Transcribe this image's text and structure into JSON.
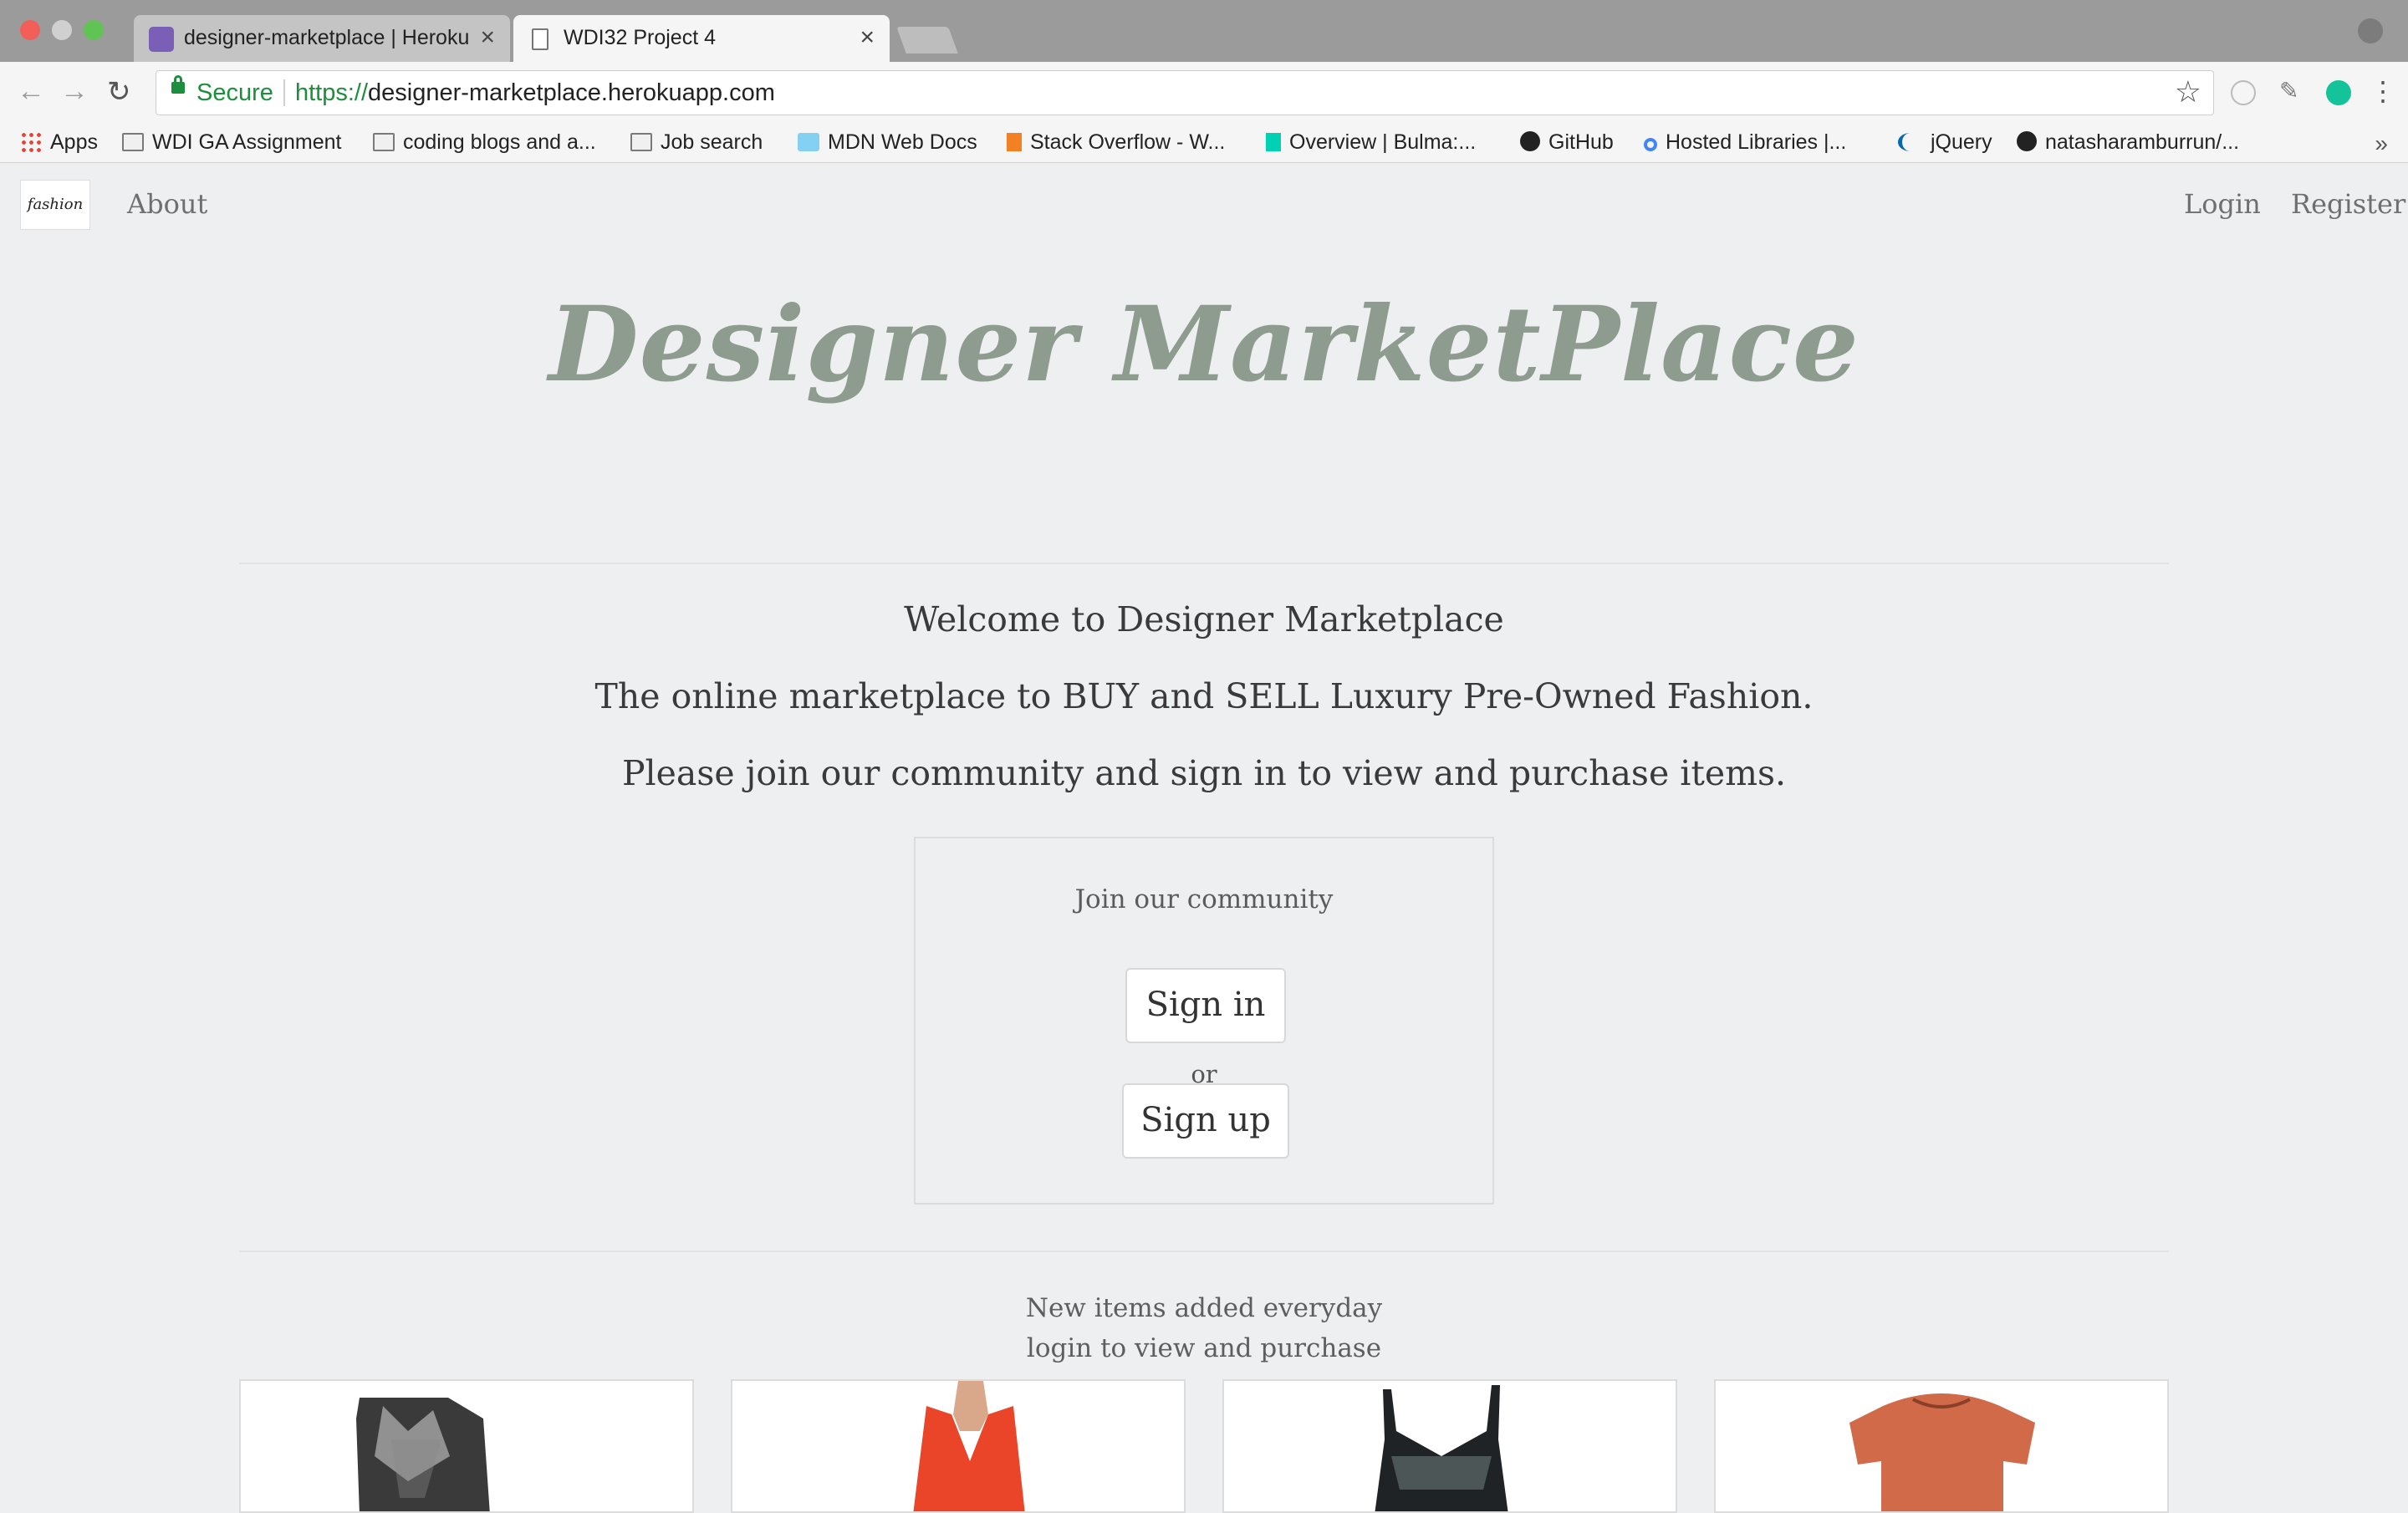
{
  "browser": {
    "tabs": [
      {
        "title": "designer-marketplace | Heroku",
        "active": false
      },
      {
        "title": "WDI32 Project 4",
        "active": true
      }
    ],
    "secure_label": "Secure",
    "url_scheme": "https://",
    "url_host": "designer-marketplace.herokuapp.com",
    "bookmarks": [
      "Apps",
      "WDI GA Assignment",
      "coding blogs and a...",
      "Job search",
      "MDN Web Docs",
      "Stack Overflow - W...",
      "Overview | Bulma:...",
      "GitHub",
      "Hosted Libraries |...",
      "jQuery",
      "natasharamburrun/..."
    ]
  },
  "site": {
    "logo_text": "fashion",
    "nav": {
      "about": "About",
      "login": "Login",
      "register": "Register"
    },
    "hero_title": "Designer MarketPlace",
    "welcome": [
      "Welcome to Designer Marketplace",
      "The online marketplace to BUY and SELL Luxury Pre-Owned Fashion.",
      "Please join our community and sign in to view and purchase items."
    ],
    "join": {
      "title": "Join our community",
      "signin": "Sign in",
      "or": "or",
      "signup": "Sign up"
    },
    "promo": [
      "New items added everyday",
      "login to view and purchase"
    ]
  },
  "colors": {
    "hero": "#8e9b8f",
    "page_bg": "#eeeff0",
    "secure_green": "#1e8e3e"
  }
}
